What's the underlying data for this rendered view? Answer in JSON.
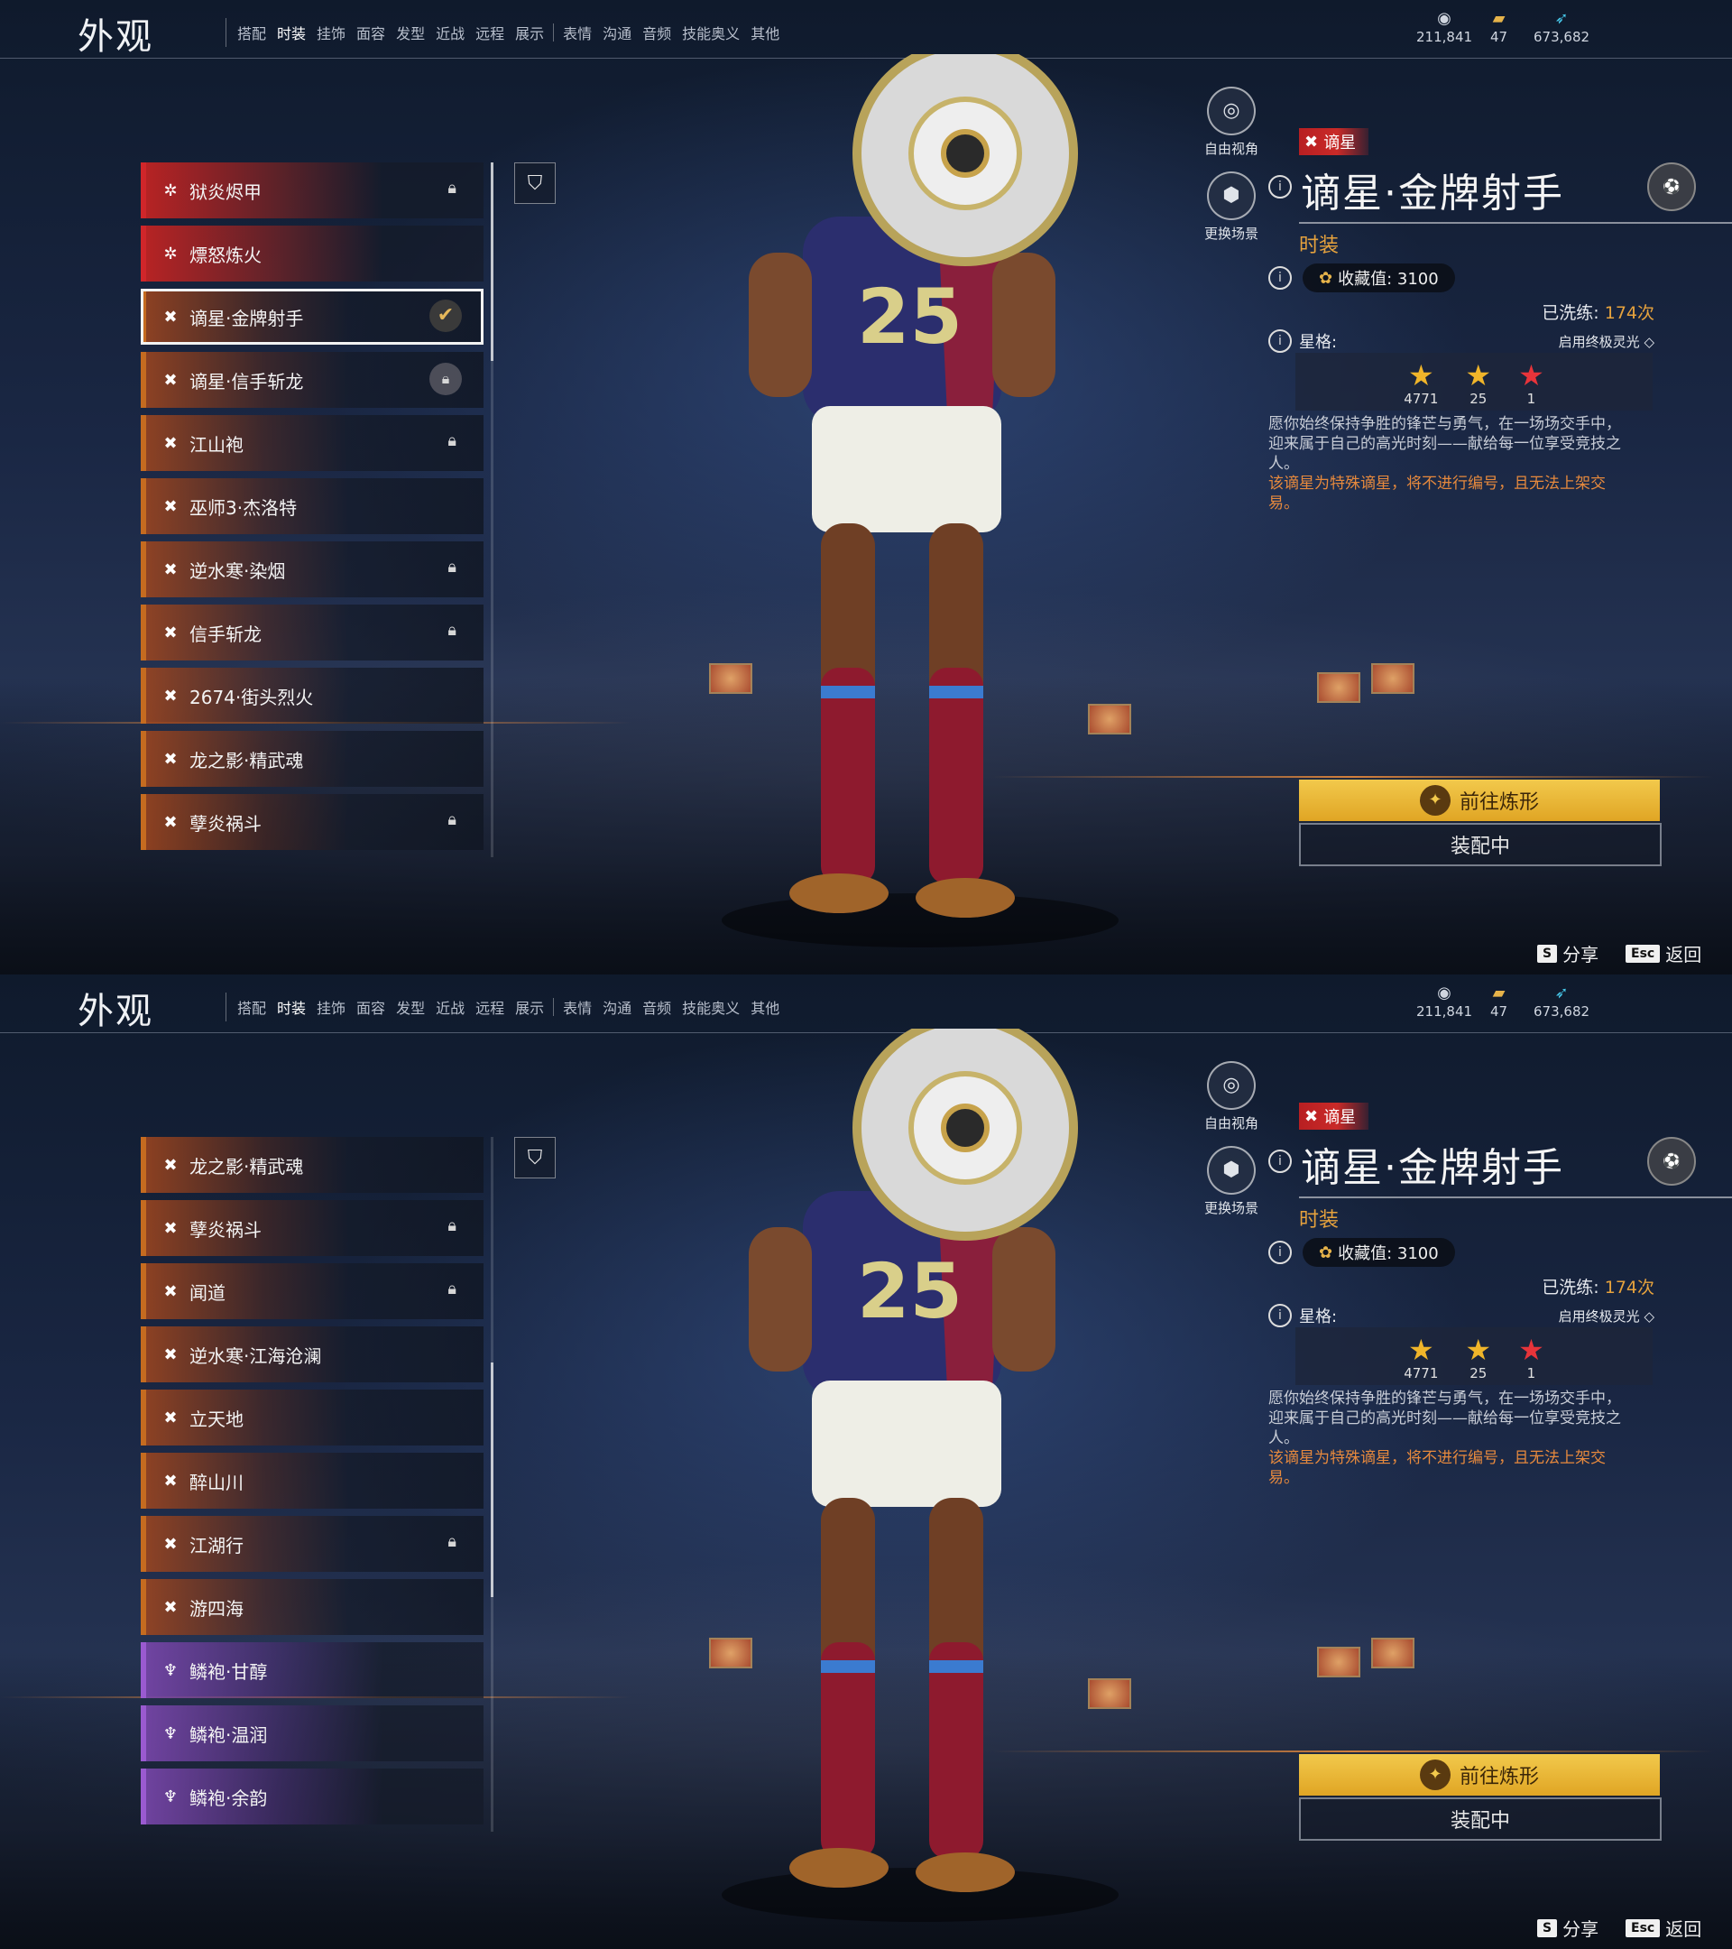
{
  "screens": [
    {
      "header": {
        "title": "外观",
        "tabs": [
          "搭配",
          "时装",
          "挂饰",
          "面容",
          "发型",
          "近战",
          "远程",
          "展示"
        ],
        "tabs2": [
          "表情",
          "沟通",
          "音频",
          "技能奥义",
          "其他"
        ],
        "active_tab": "时装",
        "currencies": [
          {
            "icon": "coin-icon",
            "value": "211,841"
          },
          {
            "icon": "ticket-icon",
            "value": "47"
          },
          {
            "icon": "feather-icon",
            "value": "673,682"
          }
        ]
      },
      "list": [
        {
          "label": "狱炎烬甲",
          "rarity": "red",
          "lock": true
        },
        {
          "label": "熛怒炼火",
          "rarity": "red",
          "lock": false
        },
        {
          "label": "谪星·金牌射手",
          "rarity": "orange",
          "selected": true,
          "equipped": true
        },
        {
          "label": "谪星·信手斩龙",
          "rarity": "orange",
          "lockbadge": true
        },
        {
          "label": "江山袍",
          "rarity": "orange",
          "lock": true
        },
        {
          "label": "巫师3·杰洛特",
          "rarity": "orange"
        },
        {
          "label": "逆水寒·染烟",
          "rarity": "orange",
          "lock": true
        },
        {
          "label": "信手斩龙",
          "rarity": "orange",
          "lock": true
        },
        {
          "label": "2674·街头烈火",
          "rarity": "orange"
        },
        {
          "label": "龙之影·精武魂",
          "rarity": "orange"
        },
        {
          "label": "孽炎祸斗",
          "rarity": "orange",
          "lock": true
        }
      ],
      "detail": {
        "free_view": "自由视角",
        "change_scene": "更换场景",
        "rank": "谪星",
        "name": "谪星·金牌射手",
        "category": "时装",
        "collect_label": "收藏值: 3100",
        "washed_label": "已洗练: ",
        "washed_count": "174次",
        "star_label": "星格:",
        "ultimate": "启用终极灵光",
        "stars": [
          {
            "value": "4771",
            "color": "#f0b52a"
          },
          {
            "value": "25",
            "color": "#f0b52a"
          },
          {
            "value": "1",
            "color": "#e8343a"
          }
        ],
        "desc": "愿你始终保持争胜的锋芒与勇气，在一场场交手中，迎来属于自己的高光时刻——献给每一位享受竞技之人。",
        "warn": "该谪星为特殊谪星，将不进行编号，且无法上架交易。",
        "btn_refine": "前往炼形",
        "btn_equipped": "装配中",
        "share_key": "S",
        "share": "分享",
        "back_key": "Esc",
        "back": "返回"
      }
    },
    {
      "header": {
        "title": "外观",
        "tabs": [
          "搭配",
          "时装",
          "挂饰",
          "面容",
          "发型",
          "近战",
          "远程",
          "展示"
        ],
        "tabs2": [
          "表情",
          "沟通",
          "音频",
          "技能奥义",
          "其他"
        ],
        "active_tab": "时装",
        "currencies": [
          {
            "icon": "coin-icon",
            "value": "211,841"
          },
          {
            "icon": "ticket-icon",
            "value": "47"
          },
          {
            "icon": "feather-icon",
            "value": "673,682"
          }
        ]
      },
      "list": [
        {
          "label": "龙之影·精武魂",
          "rarity": "orange"
        },
        {
          "label": "孽炎祸斗",
          "rarity": "orange",
          "lock": true
        },
        {
          "label": "闻道",
          "rarity": "orange",
          "lock": true
        },
        {
          "label": "逆水寒·江海沧澜",
          "rarity": "orange"
        },
        {
          "label": "立天地",
          "rarity": "orange"
        },
        {
          "label": "醉山川",
          "rarity": "orange"
        },
        {
          "label": "江湖行",
          "rarity": "orange",
          "lock": true
        },
        {
          "label": "游四海",
          "rarity": "orange"
        },
        {
          "label": "鳞袍·甘醇",
          "rarity": "purple"
        },
        {
          "label": "鳞袍·温润",
          "rarity": "purple"
        },
        {
          "label": "鳞袍·余韵",
          "rarity": "purple"
        }
      ],
      "detail": {
        "free_view": "自由视角",
        "change_scene": "更换场景",
        "rank": "谪星",
        "name": "谪星·金牌射手",
        "category": "时装",
        "collect_label": "收藏值: 3100",
        "washed_label": "已洗练: ",
        "washed_count": "174次",
        "star_label": "星格:",
        "ultimate": "启用终极灵光",
        "stars": [
          {
            "value": "4771",
            "color": "#f0b52a"
          },
          {
            "value": "25",
            "color": "#f0b52a"
          },
          {
            "value": "1",
            "color": "#e8343a"
          }
        ],
        "desc": "愿你始终保持争胜的锋芒与勇气，在一场场交手中，迎来属于自己的高光时刻——献给每一位享受竞技之人。",
        "warn": "该谪星为特殊谪星，将不进行编号，且无法上架交易。",
        "btn_refine": "前往炼形",
        "btn_equipped": "装配中",
        "share_key": "S",
        "share": "分享",
        "back_key": "Esc",
        "back": "返回"
      }
    }
  ]
}
